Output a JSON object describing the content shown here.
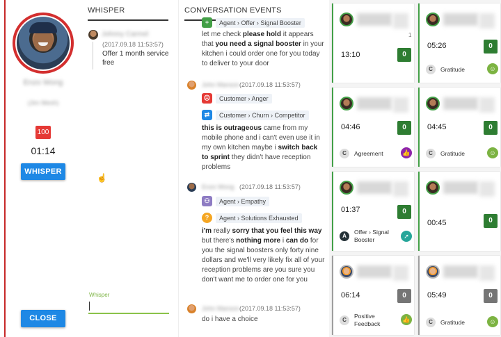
{
  "agent": {
    "name": "Enzo Wong",
    "role": "(Jim Mesh)",
    "score": "100",
    "timer": "01:14",
    "whisper_button": "WHISPER",
    "close_button": "CLOSE"
  },
  "tabs": {
    "whisper": "WHISPER",
    "conversation": "CONVERSATION",
    "events": "EVENTS"
  },
  "whisper_panel": {
    "entry": {
      "name": "Johnny Carmel",
      "time": "(2017.09.18 11:53:57)",
      "text": "Offer 1 month service free"
    },
    "input_label": "Whisper",
    "input_value": ""
  },
  "conversation": {
    "top_tag": "Agent › Offer › Signal Booster",
    "msg1": {
      "pre": "let me check ",
      "b1": "please hold",
      "mid": " it appears that ",
      "b2": "you need a signal booster",
      "post": " in your kitchen i could order one for you today to deliver to your door"
    },
    "customer_block": {
      "name": "John Manson",
      "time": "(2017.09.18 11:53:57)",
      "tag1": "Customer › Anger",
      "tag2": "Customer › Churn › Competitor",
      "b1": "this is outrageous",
      "t1": " came from my mobile phone and i can't even use it in my own kitchen maybe i ",
      "b2": "switch back to sprint",
      "t2": " they didn't have reception problems"
    },
    "agent_block": {
      "name": "Enzo Wong",
      "time": "(2017.09.18 11:53:57)",
      "tag1": "Agent › Empathy",
      "tag2": "Agent › Solutions Exhausted",
      "b1": "i'm",
      "t1": " really ",
      "b2": "sorry that you feel this way",
      "t2": " but there's ",
      "b3": "nothing more",
      "t3": " i ",
      "b4": "can do",
      "t4": " for you the signal boosters only forty nine dollars and we'll very likely fix all of your reception problems are you sure you don't want me to order one for you"
    },
    "last_block": {
      "name": "John Manson",
      "time": "(2017.09.18 11:53:57)",
      "text": "do i have a choice"
    }
  },
  "cards": [
    {
      "timer": "13:10",
      "score": "0",
      "count": "1",
      "circle": "",
      "label": "",
      "icon": ""
    },
    {
      "timer": "05:26",
      "score": "0",
      "circle": "C",
      "label": "Gratitude",
      "icon": "smile-icon"
    },
    {
      "timer": "04:46",
      "score": "0",
      "circle": "C",
      "label": "Agreement",
      "icon": "thumbs-up-icon"
    },
    {
      "timer": "04:45",
      "score": "0",
      "circle": "C",
      "label": "Gratitude",
      "icon": "smile-icon"
    },
    {
      "timer": "01:37",
      "score": "0",
      "circle": "A",
      "label": "Offer › Signal Booster",
      "icon": "arrow-icon"
    },
    {
      "timer": "00:45",
      "score": "0",
      "circle": "",
      "label": "",
      "icon": ""
    },
    {
      "timer": "06:14",
      "score": "0",
      "circle": "C",
      "label": "Positive Feedback",
      "icon": "thumbs-up-icon"
    },
    {
      "timer": "05:49",
      "score": "0",
      "circle": "C",
      "label": "Gratitude",
      "icon": "smile-icon"
    }
  ],
  "colors": {
    "accent": "#1e88e5",
    "green": "#43a047",
    "red": "#d32f2f",
    "purple": "#8e24aa"
  }
}
